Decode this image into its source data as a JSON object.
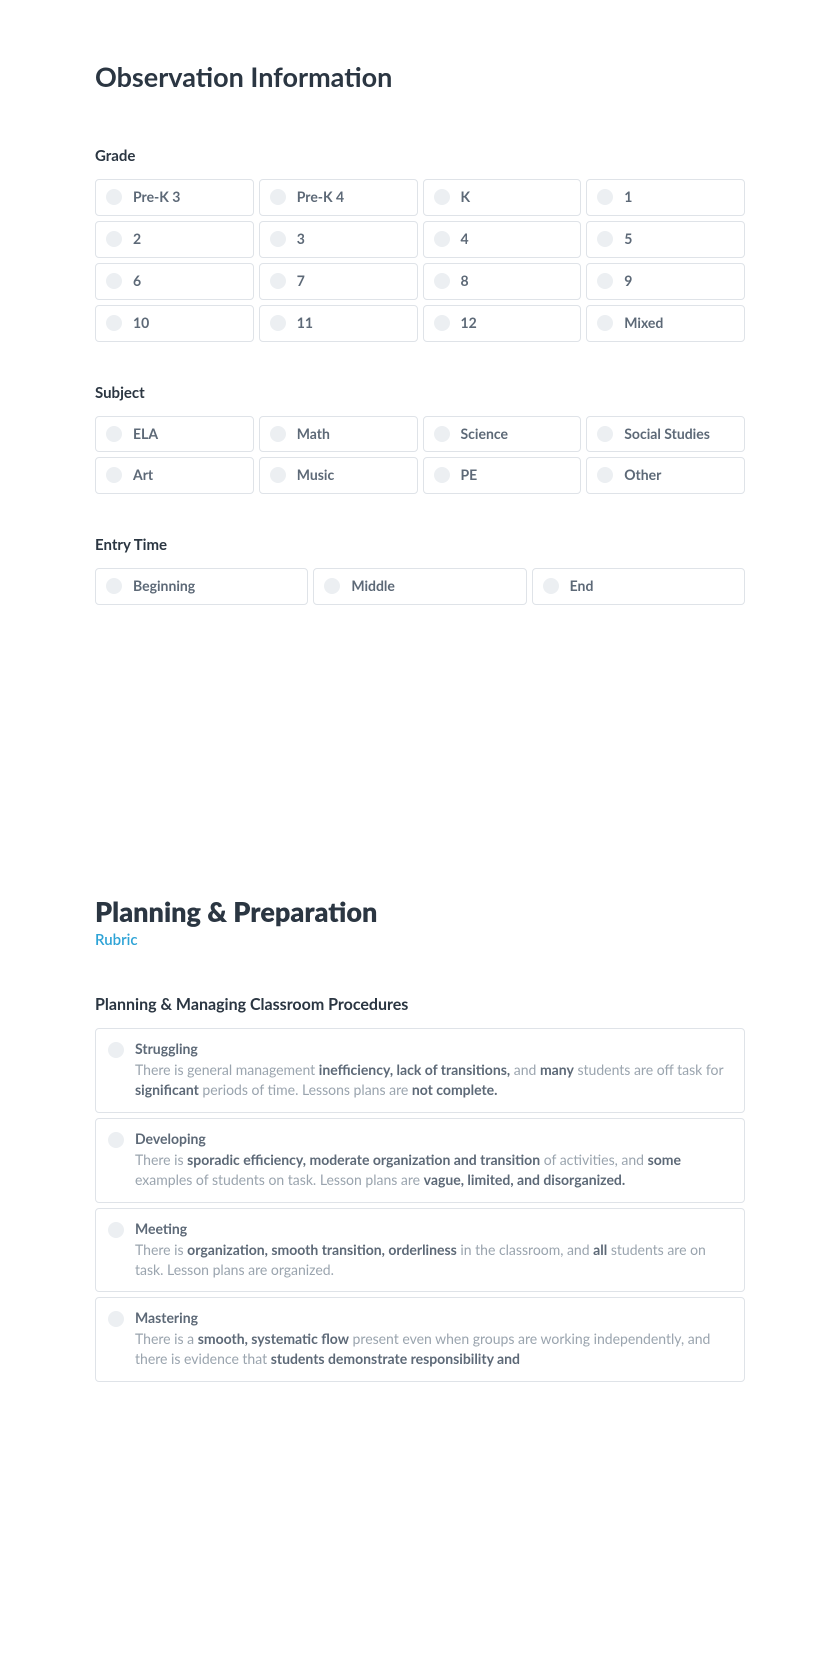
{
  "section1": {
    "title": "Observation Information",
    "grade": {
      "label": "Grade",
      "options": [
        "Pre-K 3",
        "Pre-K 4",
        "K",
        "1",
        "2",
        "3",
        "4",
        "5",
        "6",
        "7",
        "8",
        "9",
        "10",
        "11",
        "12",
        "Mixed"
      ]
    },
    "subject": {
      "label": "Subject",
      "options": [
        "ELA",
        "Math",
        "Science",
        "Social Studies",
        "Art",
        "Music",
        "PE",
        "Other"
      ]
    },
    "entryTime": {
      "label": "Entry Time",
      "options": [
        "Beginning",
        "Middle",
        "End"
      ]
    }
  },
  "section2": {
    "title": "Planning & Preparation",
    "rubric_link": "Rubric",
    "subsection": {
      "title": "Planning & Managing Classroom Procedures",
      "levels": [
        {
          "name": "Struggling",
          "parts": [
            {
              "t": "There is general management ",
              "b": false
            },
            {
              "t": "inefficiency, lack of transitions,",
              "b": true
            },
            {
              "t": " and ",
              "b": false
            },
            {
              "t": "many",
              "b": true
            },
            {
              "t": " students are off task for ",
              "b": false
            },
            {
              "t": "significant",
              "b": true
            },
            {
              "t": " periods of time. Lessons plans are ",
              "b": false
            },
            {
              "t": "not complete.",
              "b": true
            }
          ]
        },
        {
          "name": "Developing",
          "parts": [
            {
              "t": "There is ",
              "b": false
            },
            {
              "t": "sporadic efficiency, moderate organization and transition",
              "b": true
            },
            {
              "t": " of activities, and ",
              "b": false
            },
            {
              "t": "some",
              "b": true
            },
            {
              "t": " examples of students on task. Lesson plans are ",
              "b": false
            },
            {
              "t": "vague, limited, and disorganized.",
              "b": true
            }
          ]
        },
        {
          "name": "Meeting",
          "parts": [
            {
              "t": "There is ",
              "b": false
            },
            {
              "t": "organization, smooth transition, orderliness",
              "b": true
            },
            {
              "t": " in the classroom, and ",
              "b": false
            },
            {
              "t": "all",
              "b": true
            },
            {
              "t": " students are on task. Lesson plans are organized.",
              "b": false
            }
          ]
        },
        {
          "name": "Mastering",
          "parts": [
            {
              "t": "There is a ",
              "b": false
            },
            {
              "t": "smooth, systematic flow",
              "b": true
            },
            {
              "t": " present even when groups are working independently, and there is evidence that ",
              "b": false
            },
            {
              "t": "students demonstrate responsibility and",
              "b": true
            }
          ]
        }
      ]
    }
  }
}
